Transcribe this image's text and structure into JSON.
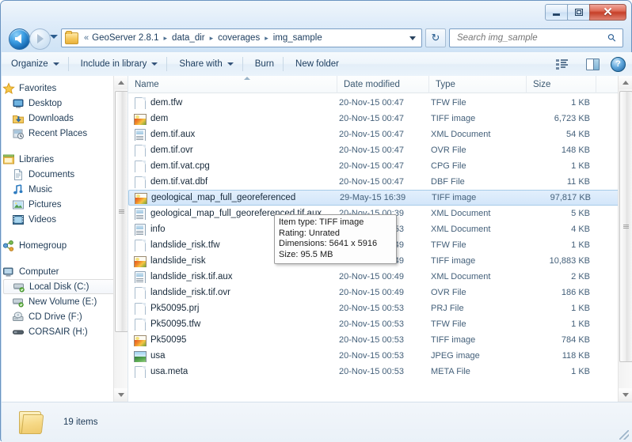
{
  "window": {
    "caption": {
      "minimize_label": "Minimize",
      "maximize_label": "Maximize",
      "close_label": "✕"
    }
  },
  "address_bar": {
    "folder_icon": "folder-icon",
    "overflow_chevron": "«",
    "crumbs": [
      "GeoServer 2.8.1",
      "data_dir",
      "coverages",
      "img_sample"
    ],
    "separator": "▸",
    "dropdown_icon": "chevron-down-icon",
    "refresh_icon": "↻"
  },
  "navigation": {
    "back_icon": "back-arrow-icon",
    "forward_icon": "forward-arrow-icon",
    "recent_pages_icon": "chevron-down-icon"
  },
  "search": {
    "placeholder": "Search img_sample",
    "value": "",
    "icon": "search-icon"
  },
  "command_bar": {
    "items": [
      {
        "label": "Organize",
        "has_caret": true
      },
      {
        "label": "Include in library",
        "has_caret": true
      },
      {
        "label": "Share with",
        "has_caret": true
      },
      {
        "label": "Burn",
        "has_caret": false
      },
      {
        "label": "New folder",
        "has_caret": false
      }
    ],
    "view_icon": "view-list-icon",
    "view_caret_icon": "chevron-down-icon",
    "preview_pane_icon": "preview-pane-icon",
    "help_icon": "help-icon",
    "help_glyph": "?"
  },
  "sidebar": {
    "groups": [
      {
        "header": {
          "label": "Favorites",
          "icon": "star-icon"
        },
        "items": [
          {
            "label": "Desktop",
            "icon": "desktop-icon"
          },
          {
            "label": "Downloads",
            "icon": "downloads-icon"
          },
          {
            "label": "Recent Places",
            "icon": "recent-places-icon"
          }
        ]
      },
      {
        "header": {
          "label": "Libraries",
          "icon": "libraries-icon"
        },
        "items": [
          {
            "label": "Documents",
            "icon": "documents-icon"
          },
          {
            "label": "Music",
            "icon": "music-icon"
          },
          {
            "label": "Pictures",
            "icon": "pictures-icon"
          },
          {
            "label": "Videos",
            "icon": "videos-icon"
          }
        ]
      },
      {
        "header": {
          "label": "Homegroup",
          "icon": "homegroup-icon"
        },
        "items": []
      },
      {
        "header": {
          "label": "Computer",
          "icon": "computer-icon"
        },
        "items": [
          {
            "label": "Local Disk (C:)",
            "icon": "hard-drive-icon",
            "selected": true
          },
          {
            "label": "New Volume (E:)",
            "icon": "hard-drive-icon",
            "selected": false
          },
          {
            "label": "CD Drive (F:)",
            "icon": "cd-drive-icon",
            "selected": false
          },
          {
            "label": "CORSAIR (H:)",
            "icon": "usb-drive-icon",
            "selected": false
          }
        ]
      }
    ]
  },
  "file_list": {
    "columns": [
      {
        "key": "name",
        "label": "Name",
        "sorted": true
      },
      {
        "key": "date",
        "label": "Date modified"
      },
      {
        "key": "type",
        "label": "Type"
      },
      {
        "key": "size",
        "label": "Size"
      }
    ],
    "rows": [
      {
        "name": "dem.tfw",
        "date": "20-Nov-15 00:47",
        "type": "TFW File",
        "size": "1 KB",
        "icon": "generic-file-icon",
        "selected": false
      },
      {
        "name": "dem",
        "date": "20-Nov-15 00:47",
        "type": "TIFF image",
        "size": "6,723 KB",
        "icon": "tiff-image-icon",
        "selected": false
      },
      {
        "name": "dem.tif.aux",
        "date": "20-Nov-15 00:47",
        "type": "XML Document",
        "size": "54 KB",
        "icon": "xml-document-icon",
        "selected": false
      },
      {
        "name": "dem.tif.ovr",
        "date": "20-Nov-15 00:47",
        "type": "OVR File",
        "size": "148 KB",
        "icon": "generic-file-icon",
        "selected": false
      },
      {
        "name": "dem.tif.vat.cpg",
        "date": "20-Nov-15 00:47",
        "type": "CPG File",
        "size": "1 KB",
        "icon": "generic-file-icon",
        "selected": false
      },
      {
        "name": "dem.tif.vat.dbf",
        "date": "20-Nov-15 00:47",
        "type": "DBF File",
        "size": "11 KB",
        "icon": "generic-file-icon",
        "selected": false
      },
      {
        "name": "geological_map_full_georeferenced",
        "date": "29-May-15 16:39",
        "type": "TIFF image",
        "size": "97,817 KB",
        "icon": "tiff-image-icon",
        "selected": true
      },
      {
        "name": "geological_map_full_georeferenced.tif.aux",
        "date": "20-Nov-15 00:39",
        "type": "XML Document",
        "size": "5 KB",
        "icon": "xml-document-icon",
        "selected": false
      },
      {
        "name": "info",
        "date": "20-Nov-15 00:53",
        "type": "XML Document",
        "size": "4 KB",
        "icon": "xml-document-icon",
        "selected": false
      },
      {
        "name": "landslide_risk.tfw",
        "date": "20-Nov-15 00:49",
        "type": "TFW File",
        "size": "1 KB",
        "icon": "generic-file-icon",
        "selected": false
      },
      {
        "name": "landslide_risk",
        "date": "20-Nov-15 00:49",
        "type": "TIFF image",
        "size": "10,883 KB",
        "icon": "tiff-image-icon",
        "selected": false
      },
      {
        "name": "landslide_risk.tif.aux",
        "date": "20-Nov-15 00:49",
        "type": "XML Document",
        "size": "2 KB",
        "icon": "xml-document-icon",
        "selected": false
      },
      {
        "name": "landslide_risk.tif.ovr",
        "date": "20-Nov-15 00:49",
        "type": "OVR File",
        "size": "186 KB",
        "icon": "generic-file-icon",
        "selected": false
      },
      {
        "name": "Pk50095.prj",
        "date": "20-Nov-15 00:53",
        "type": "PRJ File",
        "size": "1 KB",
        "icon": "generic-file-icon",
        "selected": false
      },
      {
        "name": "Pk50095.tfw",
        "date": "20-Nov-15 00:53",
        "type": "TFW File",
        "size": "1 KB",
        "icon": "generic-file-icon",
        "selected": false
      },
      {
        "name": "Pk50095",
        "date": "20-Nov-15 00:53",
        "type": "TIFF image",
        "size": "784 KB",
        "icon": "tiff-image-icon",
        "selected": false
      },
      {
        "name": "usa",
        "date": "20-Nov-15 00:53",
        "type": "JPEG image",
        "size": "118 KB",
        "icon": "jpeg-image-icon",
        "selected": false
      },
      {
        "name": "usa.meta",
        "date": "20-Nov-15 00:53",
        "type": "META File",
        "size": "1 KB",
        "icon": "generic-file-icon",
        "selected": false
      }
    ]
  },
  "tooltip": {
    "lines": [
      "Item type: TIFF image",
      "Rating: Unrated",
      "Dimensions: 5641 x 5916",
      "Size: 95.5 MB"
    ]
  },
  "status_bar": {
    "item_count_text": "19 items",
    "folder_icon": "folder-icon"
  },
  "colors": {
    "selection_fill": "#d3e6fa",
    "selection_border": "#a6cbe8",
    "close_button": "#c63f28",
    "accent_blue": "#1b3c5e"
  }
}
